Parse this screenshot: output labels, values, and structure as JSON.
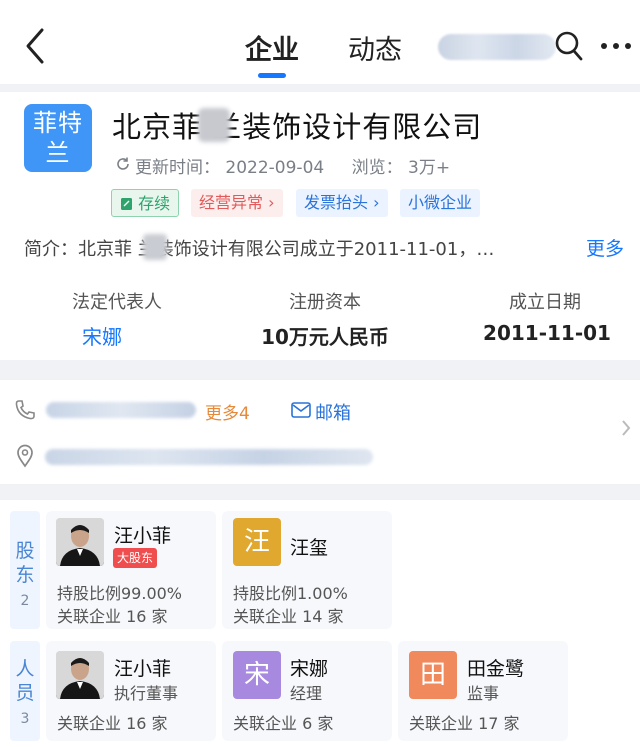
{
  "header": {
    "tabs": [
      {
        "label": "企业",
        "active": true
      },
      {
        "label": "动态",
        "active": false
      }
    ],
    "accent": "#1677ff"
  },
  "company": {
    "logo_lines": [
      "菲特",
      "兰"
    ],
    "logo_color": "#3f96f7",
    "name": "北京菲  兰装饰设计有限公司",
    "update_label": "更新时间：",
    "update_date": "2022-09-04",
    "views_label": "浏览：",
    "views_value": "3万+",
    "tags": [
      "存续",
      "经营异常",
      "发票抬头",
      "小微企业"
    ],
    "intro": "简介：北京菲  兰装饰设计有限公司成立于2011-11-01，…",
    "intro_more": "更多",
    "info": [
      {
        "label": "法定代表人",
        "value": "宋娜"
      },
      {
        "label": "注册资本",
        "value": "10万元人民币"
      },
      {
        "label": "成立日期",
        "value": "2011-11-01"
      }
    ]
  },
  "contact": {
    "more_phones": "更多4",
    "mail": "邮箱"
  },
  "shareholders": {
    "label": "股东",
    "count": "2",
    "items": [
      {
        "name": "汪小菲",
        "badge": "大股东",
        "ratio": "持股比例99.00%",
        "related": "关联企业 16 家",
        "avatar": "photo"
      },
      {
        "name": "汪玺",
        "avatar_char": "汪",
        "avatar_color": "#e0a82e",
        "ratio": "持股比例1.00%",
        "related": "关联企业 14 家"
      }
    ]
  },
  "personnel": {
    "label": "人员",
    "count": "3",
    "items": [
      {
        "name": "汪小菲",
        "role": "执行董事",
        "related": "关联企业 16 家",
        "avatar": "photo"
      },
      {
        "name": "宋娜",
        "role": "经理",
        "avatar_char": "宋",
        "avatar_color": "#a78ae0",
        "related": "关联企业 6 家"
      },
      {
        "name": "田金鹭",
        "role": "监事",
        "avatar_char": "田",
        "avatar_color": "#f08a5d",
        "related": "关联企业 17 家"
      }
    ]
  }
}
